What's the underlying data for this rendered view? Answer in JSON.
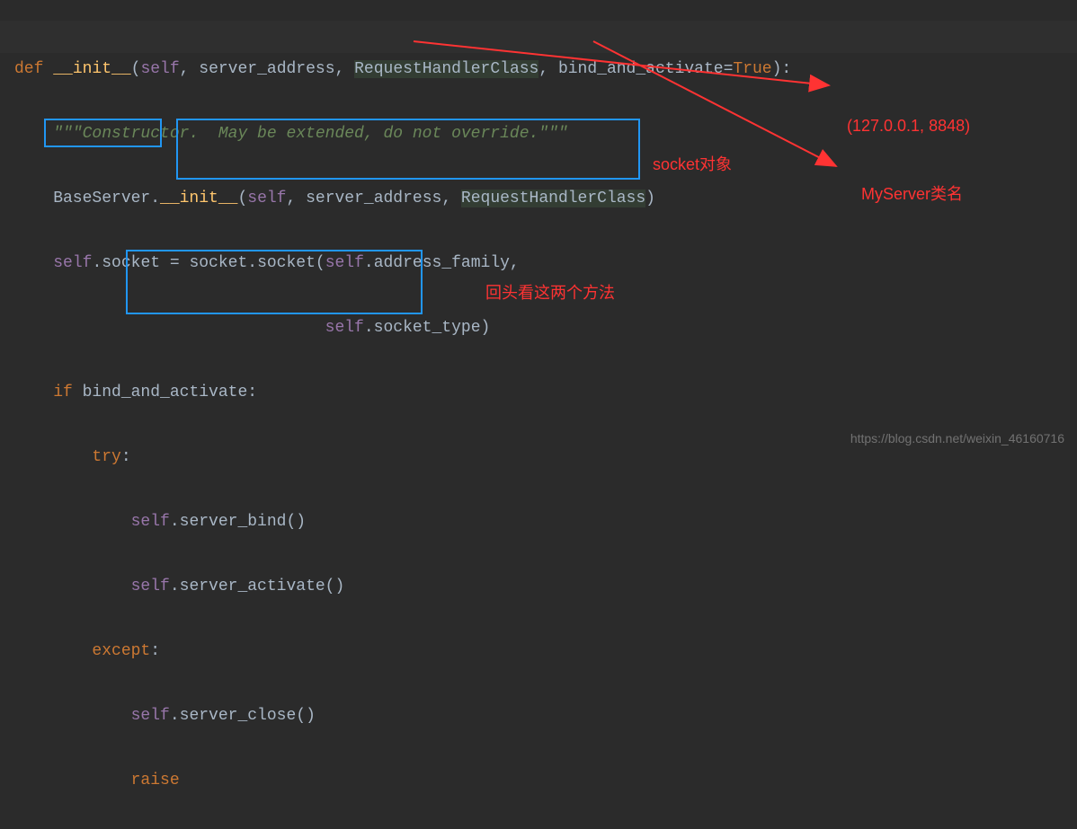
{
  "code": {
    "l1": {
      "def": "def ",
      "fn": "__init__",
      "p1": "(",
      "self": "self",
      "c1": ", server_address, ",
      "rhc": "RequestHandlerClass",
      "c2": ", bind_and_activate=",
      "true": "True",
      "p2": "):"
    },
    "l2": "    \"\"\"Constructor.  May be extended, do not override.\"\"\"",
    "l3": {
      "a": "    BaseServer.",
      "b": "__init__",
      "c": "(",
      "self": "self",
      "d": ", server_address, ",
      "rhc": "RequestHandlerClass",
      "e": ")"
    },
    "l4": {
      "a": "    ",
      "self": "self",
      "b": ".socket = socket.socket(",
      "self2": "self",
      "c": ".address_family,"
    },
    "l5": {
      "a": "                                ",
      "self": "self",
      "b": ".socket_type)"
    },
    "l6": {
      "a": "    ",
      "if": "if ",
      "b": "bind_and_activate:"
    },
    "l7": {
      "a": "        ",
      "try": "try",
      "b": ":"
    },
    "l8": {
      "a": "            ",
      "self": "self",
      "b": ".server_bind()"
    },
    "l9": {
      "a": "            ",
      "self": "self",
      "b": ".server_activate()"
    },
    "l10": {
      "a": "        ",
      "except": "except",
      "b": ":"
    },
    "l11": {
      "a": "            ",
      "self": "self",
      "b": ".server_close()"
    },
    "l12": {
      "a": "            ",
      "raise": "raise"
    }
  },
  "annotations": {
    "socket_obj": "socket对象",
    "addr": "(127.0.0.1, 8848)",
    "myserver": "MyServer类名",
    "methods": "回头看这两个方法"
  },
  "watermark": "https://blog.csdn.net/weixin_46160716"
}
